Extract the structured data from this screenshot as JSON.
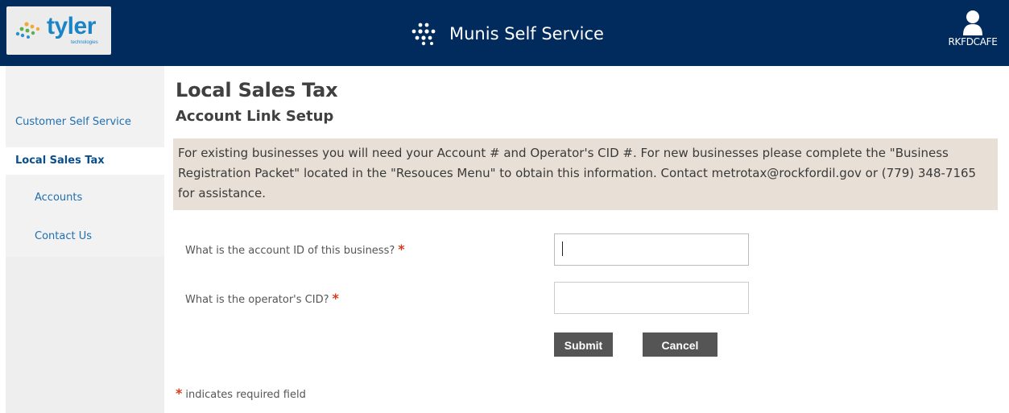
{
  "header": {
    "logo_text": "tyler",
    "logo_subtext": "technologies",
    "app_title": "Munis Self Service",
    "user_name": "RKFDCAFE"
  },
  "sidebar": {
    "items": [
      {
        "label": "Customer Self Service"
      },
      {
        "label": "Local Sales Tax"
      },
      {
        "label": "Accounts"
      },
      {
        "label": "Contact Us"
      }
    ]
  },
  "main": {
    "title": "Local Sales Tax",
    "subtitle": "Account Link Setup",
    "info": "For existing businesses you will need your Account # and Operator's CID #. For new businesses please complete the \"Business Registration Packet\" located in the \"Resouces Menu\" to obtain this information. Contact metrotax@rockfordil.gov or (779) 348-7165 for assistance.",
    "form": {
      "account_label": "What is the account ID of this business?",
      "account_value": "",
      "cid_label": "What is the operator's CID?",
      "cid_value": "",
      "required_mark": "*",
      "submit_label": "Submit",
      "cancel_label": "Cancel"
    },
    "required_note": "indicates required field"
  },
  "colors": {
    "header_bg": "#002b5c",
    "link": "#1f6fb0",
    "required": "#d93a1a",
    "button_bg": "#555555",
    "info_bg": "#e8e0d6"
  },
  "icons": {
    "logo": "tyler-logo-icon",
    "app": "munis-dots-icon",
    "user": "user-icon"
  }
}
